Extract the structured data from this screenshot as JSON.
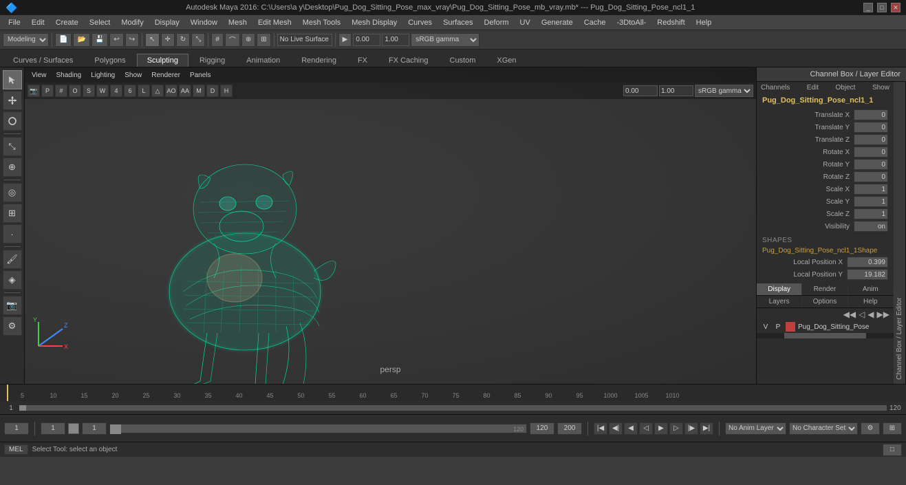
{
  "titlebar": {
    "text": "Autodesk Maya 2016: C:\\Users\\a y\\Desktop\\Pug_Dog_Sitting_Pose_max_vray\\Pug_Dog_Sitting_Pose_mb_vray.mb* --- Pug_Dog_Sitting_Pose_ncl1_1",
    "controls": [
      "_",
      "□",
      "✕"
    ]
  },
  "menubar": {
    "items": [
      "File",
      "Edit",
      "Create",
      "Select",
      "Modify",
      "Display",
      "Window",
      "Mesh",
      "Edit Mesh",
      "Mesh Tools",
      "Mesh Display",
      "Curves",
      "Surfaces",
      "Deform",
      "UV",
      "Generate",
      "Cache",
      "-3DtoAll-",
      "Redshift",
      "Help"
    ]
  },
  "toolbar1": {
    "workspace_select": "Modeling",
    "gamma_value": "sRGB gamma",
    "live_surface": "No Live Surface",
    "val1": "0.00",
    "val2": "1.00"
  },
  "tabbar": {
    "tabs": [
      "Curves / Surfaces",
      "Polygons",
      "Sculpting",
      "Rigging",
      "Animation",
      "Rendering",
      "FX",
      "FX Caching",
      "Custom",
      "XGen"
    ],
    "active": "Sculpting"
  },
  "viewport": {
    "menus": [
      "View",
      "Shading",
      "Lighting",
      "Show",
      "Renderer",
      "Panels"
    ],
    "label": "persp",
    "gamma_select": "sRGB gamma"
  },
  "left_toolbar": {
    "buttons": [
      "↖",
      "↔",
      "↻",
      "⊕",
      "◎",
      "⊞",
      "⊡",
      "⊗",
      "◈",
      "⊛",
      "⊙"
    ]
  },
  "right_panel": {
    "header": "Channel Box / Layer Editor",
    "top_tabs": [
      "Channels",
      "Edit",
      "Object",
      "Show"
    ],
    "object_name": "Pug_Dog_Sitting_Pose_ncl1_1",
    "attributes": [
      {
        "label": "Translate X",
        "value": "0"
      },
      {
        "label": "Translate Y",
        "value": "0"
      },
      {
        "label": "Translate Z",
        "value": "0"
      },
      {
        "label": "Rotate X",
        "value": "0"
      },
      {
        "label": "Rotate Y",
        "value": "0"
      },
      {
        "label": "Rotate Z",
        "value": "0"
      },
      {
        "label": "Scale X",
        "value": "1"
      },
      {
        "label": "Scale Y",
        "value": "1"
      },
      {
        "label": "Scale Z",
        "value": "1"
      },
      {
        "label": "Visibility",
        "value": "on"
      }
    ],
    "shapes_label": "SHAPES",
    "shape_name": "Pug_Dog_Sitting_Pose_ncl1_1Shape",
    "local_position_x": {
      "label": "Local Position X",
      "value": "0.399"
    },
    "local_position_y": {
      "label": "Local Position Y",
      "value": "19.182"
    },
    "bottom_tabs": [
      {
        "label": "Display"
      },
      {
        "label": "Render"
      },
      {
        "label": "Anim"
      }
    ],
    "bottom_active_tab": "Display",
    "layer_tabs": [
      "Layers",
      "Options",
      "Help"
    ],
    "layer_icons": [
      "◀",
      "◁",
      "◀◀",
      "▶▶"
    ],
    "layer": {
      "v": "V",
      "p": "P",
      "color": "#c04040",
      "name": "Pug_Dog_Sitting_Pose"
    }
  },
  "timeline": {
    "ticks": [
      "5",
      "10",
      "15",
      "20",
      "25",
      "30",
      "35",
      "40",
      "45",
      "50",
      "55",
      "60",
      "65",
      "70",
      "75",
      "80",
      "85",
      "90",
      "95",
      "1000",
      "1005",
      "1010"
    ],
    "total_frames": "120",
    "end_frame": "120",
    "max_frame": "200"
  },
  "bottom_controls": {
    "current_frame_left": "1",
    "num1": "1",
    "num2": "1",
    "slider_max": "120",
    "end_frame": "120",
    "max_frame": "200",
    "no_anim_layer": "No Anim Layer",
    "no_char_set": "No Character Set"
  },
  "statusbar": {
    "mode": "MEL",
    "status_text": "Select Tool: select an object"
  }
}
